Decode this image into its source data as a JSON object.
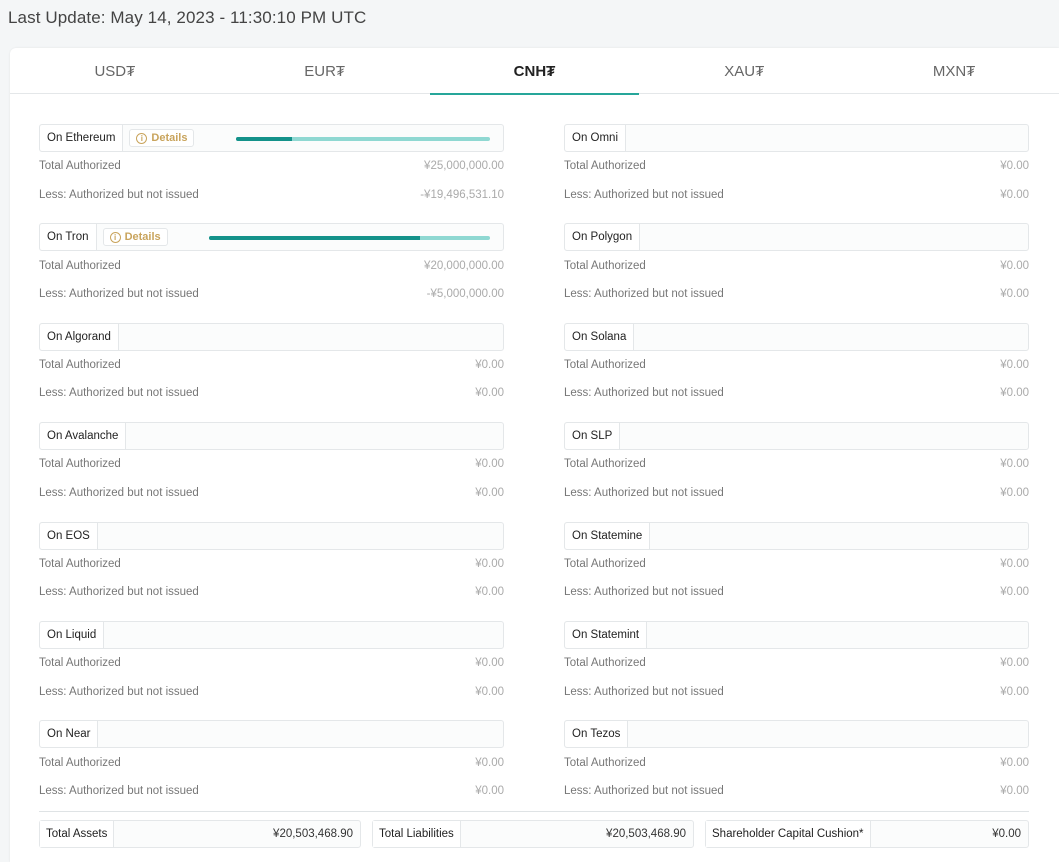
{
  "header": {
    "last_update": "Last Update: May 14, 2023 - 11:30:10 PM UTC"
  },
  "tabs": [
    {
      "label": "USD₮",
      "active": false
    },
    {
      "label": "EUR₮",
      "active": false
    },
    {
      "label": "CNH₮",
      "active": true
    },
    {
      "label": "XAU₮",
      "active": false
    },
    {
      "label": "MXN₮",
      "active": false
    }
  ],
  "labels": {
    "total_authorized": "Total Authorized",
    "less_authorized": "Less: Authorized but not issued",
    "details": "Details"
  },
  "colors": {
    "accent": "#26a69a",
    "progress_fill": "#14928a",
    "progress_track": "#8fd8d2",
    "details": "#c9a45c"
  },
  "left_chains": [
    {
      "name": "On Ethereum",
      "details": true,
      "issued_fraction": 0.22,
      "total_authorized": "¥25,000,000.00",
      "not_issued": "-¥19,496,531.10"
    },
    {
      "name": "On Tron",
      "details": true,
      "issued_fraction": 0.75,
      "total_authorized": "¥20,000,000.00",
      "not_issued": "-¥5,000,000.00"
    },
    {
      "name": "On Algorand",
      "details": false,
      "total_authorized": "¥0.00",
      "not_issued": "¥0.00"
    },
    {
      "name": "On Avalanche",
      "details": false,
      "total_authorized": "¥0.00",
      "not_issued": "¥0.00"
    },
    {
      "name": "On EOS",
      "details": false,
      "total_authorized": "¥0.00",
      "not_issued": "¥0.00"
    },
    {
      "name": "On Liquid",
      "details": false,
      "total_authorized": "¥0.00",
      "not_issued": "¥0.00"
    },
    {
      "name": "On Near",
      "details": false,
      "total_authorized": "¥0.00",
      "not_issued": "¥0.00"
    }
  ],
  "right_chains": [
    {
      "name": "On Omni",
      "total_authorized": "¥0.00",
      "not_issued": "¥0.00"
    },
    {
      "name": "On Polygon",
      "total_authorized": "¥0.00",
      "not_issued": "¥0.00"
    },
    {
      "name": "On Solana",
      "total_authorized": "¥0.00",
      "not_issued": "¥0.00"
    },
    {
      "name": "On SLP",
      "total_authorized": "¥0.00",
      "not_issued": "¥0.00"
    },
    {
      "name": "On Statemine",
      "total_authorized": "¥0.00",
      "not_issued": "¥0.00"
    },
    {
      "name": "On Statemint",
      "total_authorized": "¥0.00",
      "not_issued": "¥0.00"
    },
    {
      "name": "On Tezos",
      "total_authorized": "¥0.00",
      "not_issued": "¥0.00"
    }
  ],
  "totals": {
    "assets_label": "Total Assets",
    "assets_value": "¥20,503,468.90",
    "liabilities_label": "Total Liabilities",
    "liabilities_value": "¥20,503,468.90",
    "cushion_label": "Shareholder Capital Cushion*",
    "cushion_value": "¥0.00"
  }
}
